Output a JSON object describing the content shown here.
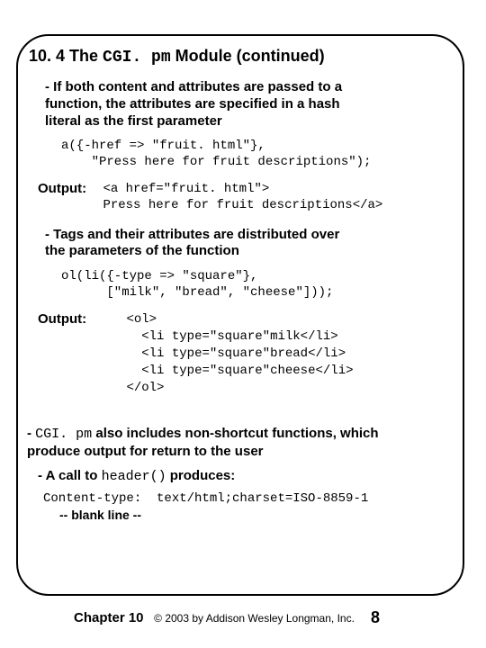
{
  "title_prefix": "10. 4 The ",
  "title_code": "CGI. pm",
  "title_suffix": " Module ",
  "title_cont": "(continued)",
  "bullet1": "- If both content and attributes are passed to a\n  function, the attributes are specified in a hash\n  literal as the first parameter",
  "code1": "a({-href => \"fruit. html\"},\n    \"Press here for fruit descriptions\");",
  "output_label": "Output:",
  "output1": "<a href=\"fruit. html\">\nPress here for fruit descriptions</a>",
  "bullet2": "- Tags and their attributes are distributed over\n   the parameters of the function",
  "code2": "ol(li({-type => \"square\"},\n      [\"milk\", \"bread\", \"cheese\"]));",
  "output2": "<ol>\n  <li type=\"square\"milk</li>\n  <li type=\"square\"bread</li>\n  <li type=\"square\"cheese</li>\n</ol>",
  "bullet3_pre": "- ",
  "bullet3_code": "CGI. pm",
  "bullet3_post": " also includes non-shortcut functions, which\n    produce output for return to the user",
  "bullet4_pre": "- A call to ",
  "bullet4_code": "header()",
  "bullet4_post": " produces:",
  "content_type": "Content-type:  text/html;charset=ISO-8859-1",
  "blank": "-- blank line --",
  "footer_chapter": "Chapter 10",
  "footer_copy": "© 2003 by Addison Wesley Longman, Inc.",
  "footer_page": "8"
}
